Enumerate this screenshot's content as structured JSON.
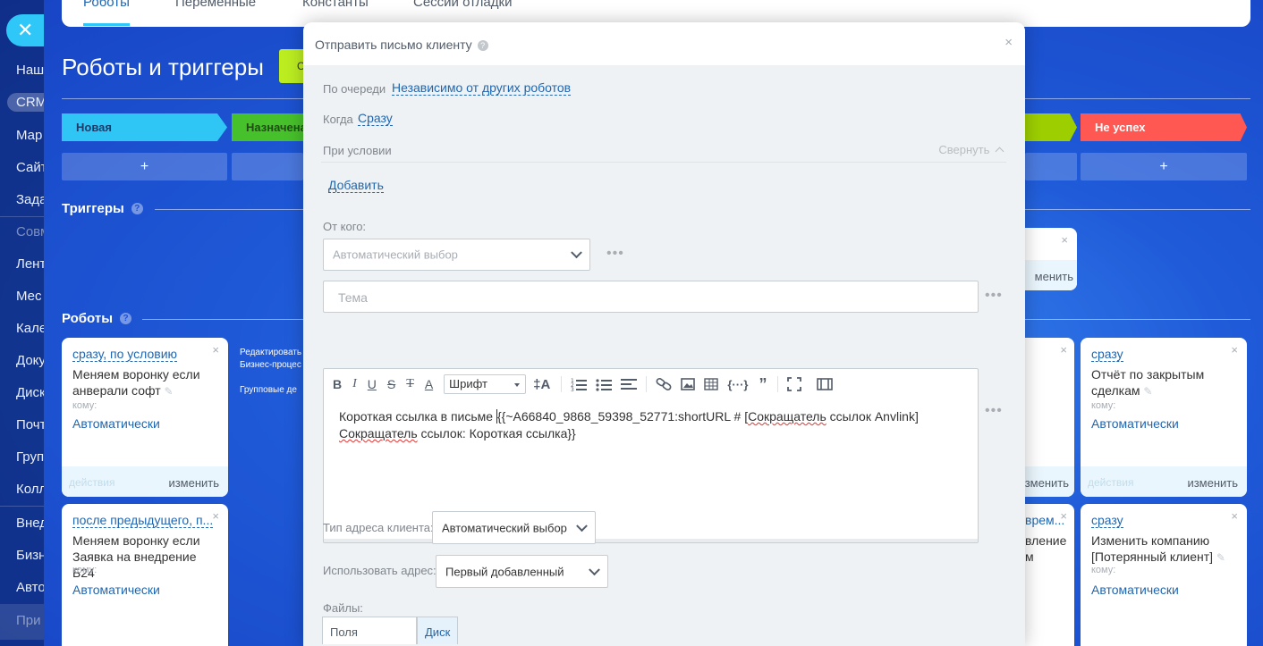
{
  "nav": {
    "items": [
      {
        "label": "Наш"
      },
      {
        "label": "CRM"
      },
      {
        "label": "Мар"
      },
      {
        "label": "Сайт"
      },
      {
        "label": "Зада"
      },
      {
        "label": "Совм"
      },
      {
        "label": "Лент"
      },
      {
        "label": "Мес"
      },
      {
        "label": "Кале"
      },
      {
        "label": "Доку"
      },
      {
        "label": "Диск"
      },
      {
        "label": "Почт"
      },
      {
        "label": "Груп"
      },
      {
        "label": "Колл"
      },
      {
        "label": "Внед"
      },
      {
        "label": "Бизн"
      },
      {
        "label": "Авто"
      },
      {
        "label": "При"
      }
    ],
    "close_glyph": "✕"
  },
  "tabs": [
    {
      "label": "Роботы"
    },
    {
      "label": "Переменные"
    },
    {
      "label": "Константы"
    },
    {
      "label": "Сессии отладки"
    }
  ],
  "page_title": "Роботы и триггеры",
  "green_button_label": "С",
  "stages": [
    {
      "label": "Новая"
    },
    {
      "label": "Назначена"
    },
    {
      "label": ""
    },
    {
      "label": "Не успех"
    }
  ],
  "add_glyph": "+",
  "triggers_label": "Триггеры",
  "robots_label": "Роботы",
  "help_glyph": "?",
  "close_glyph": "×",
  "edit_glyph": "✎",
  "trigger_card": {
    "edit_label": "изменить"
  },
  "between_text": {
    "line1": "Редактировать",
    "line2": "Бизнес-процес",
    "line3": "Групповые де"
  },
  "robot_cards": [
    {
      "link": "сразу, по условию",
      "title": "Меняем воронку если анверали софт",
      "to_label": "кому:",
      "value": "Автоматически",
      "actions_label": "действия",
      "edit_label": "изменить"
    },
    {
      "link": "после предыдущего, п...",
      "title": "Меняем воронку если Заявка на внедрение Б24",
      "to_label": "кому:",
      "value": "Автоматически"
    },
    {
      "link": "сразу",
      "title": "Отчёт по закрытым сделкам",
      "to_label": "кому:",
      "value": "Автоматически",
      "actions_label": "действия",
      "edit_label": "изменить"
    },
    {
      "link": "сразу",
      "title": "Изменить компанию [Потерянный клиент]",
      "to_label": "кому:",
      "value": "Автоматически"
    }
  ],
  "partial_cards": {
    "edit_label": "зменить",
    "edit_label2": "менить",
    "link": "врем...",
    "line1": "вление",
    "line2": "м"
  },
  "modal": {
    "title": "Отправить письмо клиенту",
    "queue_label": "По очереди",
    "queue_value": "Независимо от других роботов",
    "when_label": "Когда",
    "when_value": "Сразу",
    "condition_label": "При условии",
    "collapse_label": "Свернуть",
    "add_label": "Добавить",
    "from_label": "От кого:",
    "from_select": "Автоматический выбор",
    "subject_placeholder": "Тема",
    "dots": "•••",
    "toolbar": {
      "bold": "B",
      "italic": "I",
      "underline": "U",
      "strike": "S",
      "clear": "T",
      "color": "A",
      "font": "Шрифт",
      "size": "‡A"
    },
    "editor_text": {
      "part1": "Короткая ссылка в письме ",
      "part2": "{{~A66840_9868_59398_52771:shortURL # [",
      "part3": "Сокращатель",
      "part4": " ссылок Anvlink] ",
      "part5": "Сокращатель",
      "part6": " ссылок: Короткая ссылка}}"
    },
    "addr_type_label": "Тип адреса клиента:",
    "addr_type_value": "Автоматический выбор",
    "use_addr_label": "Использовать адрес:",
    "use_addr_value": "Первый добавленный",
    "files_label": "Файлы:",
    "files_tabs": [
      {
        "label": "Поля элемента"
      },
      {
        "label": "Диск"
      }
    ]
  }
}
